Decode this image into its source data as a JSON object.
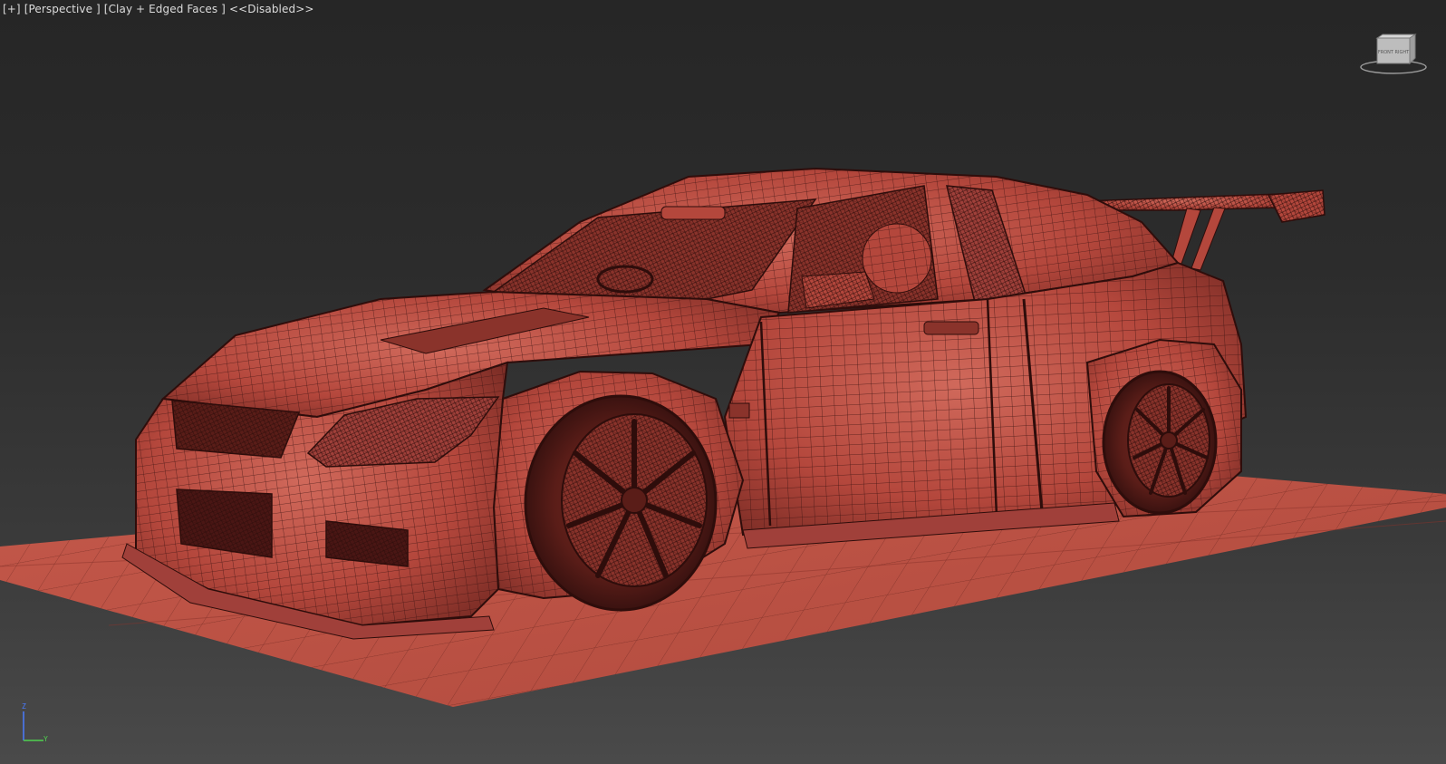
{
  "viewport": {
    "menu": "[+]",
    "view": "[Perspective ]",
    "shading": "[Clay + Edged Faces ]",
    "state": "<<Disabled>>"
  },
  "viewcube": {
    "face_label": "FRONT RIGHT",
    "icon": "viewcube-icon"
  },
  "axis_tripod": {
    "z_label": "Z",
    "y_label": "Y",
    "icon": "axis-tripod-icon"
  },
  "colors": {
    "background_top": "#262626",
    "background_bottom": "#4a4a4a",
    "clay_fill": "#b4473c",
    "clay_light": "#d0695b",
    "clay_dark": "#6a2420",
    "wire": "#3a1210",
    "ground_plane": "#c05546",
    "axis_z": "#4a7bff",
    "axis_y": "#4fd14f"
  }
}
